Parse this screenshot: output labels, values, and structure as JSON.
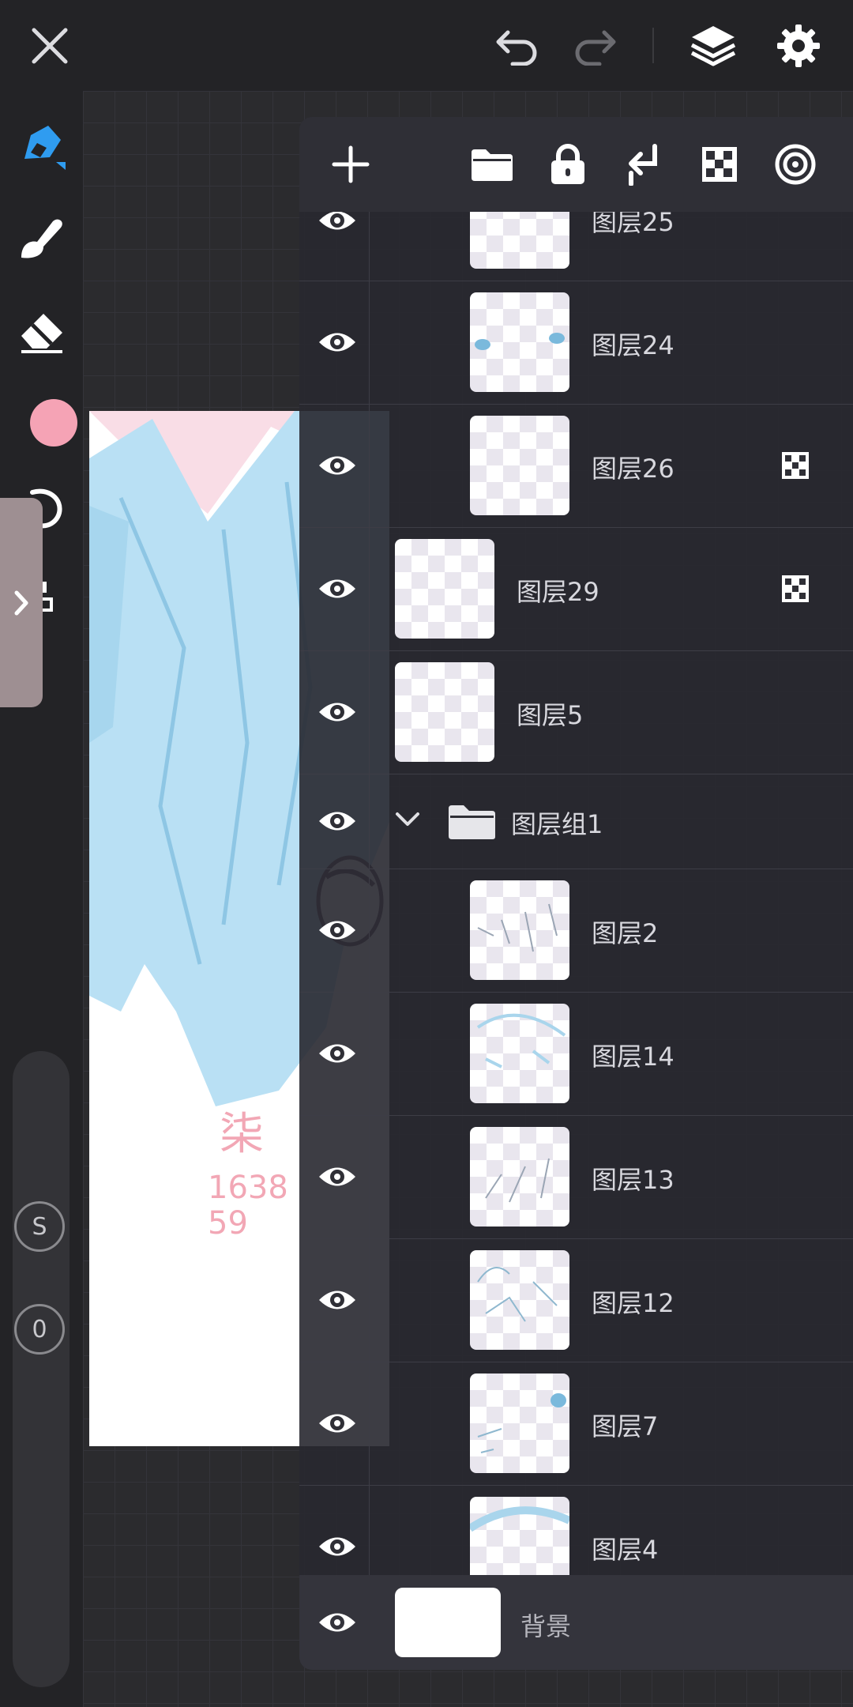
{
  "topbar": {
    "close_icon": "close-icon",
    "undo_icon": "undo-icon",
    "redo_icon": "redo-icon",
    "layers_icon": "layers-icon",
    "settings_icon": "gear-icon"
  },
  "left_tools": {
    "items": [
      "pen-tool-icon",
      "smudge-brush-icon",
      "eraser-icon",
      "color-swatch",
      "lasso-icon",
      "transform-icon"
    ],
    "color": "#f5a3b5",
    "active_color": "#2f9cf0",
    "size_label": "S",
    "opacity_label": "0"
  },
  "artwork": {
    "text_name": "柒",
    "text_number_1": "1638",
    "text_number_2": "59"
  },
  "layers_panel": {
    "toolbar": [
      "add-layer-icon",
      "new-group-folder-icon",
      "lock-icon",
      "merge-down-icon",
      "clipping-mask-icon",
      "target-icon"
    ],
    "layers": [
      {
        "name": "图层25",
        "indent": 1,
        "visible": true,
        "clipped": false
      },
      {
        "name": "图层24",
        "indent": 1,
        "visible": true,
        "clipped": false
      },
      {
        "name": "图层26",
        "indent": 1,
        "visible": true,
        "clipped": true
      },
      {
        "name": "图层29",
        "indent": 0,
        "visible": true,
        "clipped": true
      },
      {
        "name": "图层5",
        "indent": 0,
        "visible": true,
        "clipped": false
      },
      {
        "name": "图层组1",
        "group": true,
        "visible": true
      },
      {
        "name": "图层2",
        "indent": 1,
        "visible": true,
        "clipped": false
      },
      {
        "name": "图层14",
        "indent": 1,
        "visible": true,
        "clipped": false
      },
      {
        "name": "图层13",
        "indent": 1,
        "visible": true,
        "clipped": false
      },
      {
        "name": "图层12",
        "indent": 1,
        "visible": true,
        "clipped": false
      },
      {
        "name": "图层7",
        "indent": 1,
        "visible": true,
        "clipped": false
      },
      {
        "name": "图层4",
        "indent": 1,
        "visible": true,
        "clipped": false
      }
    ],
    "background_layer": "背景"
  }
}
